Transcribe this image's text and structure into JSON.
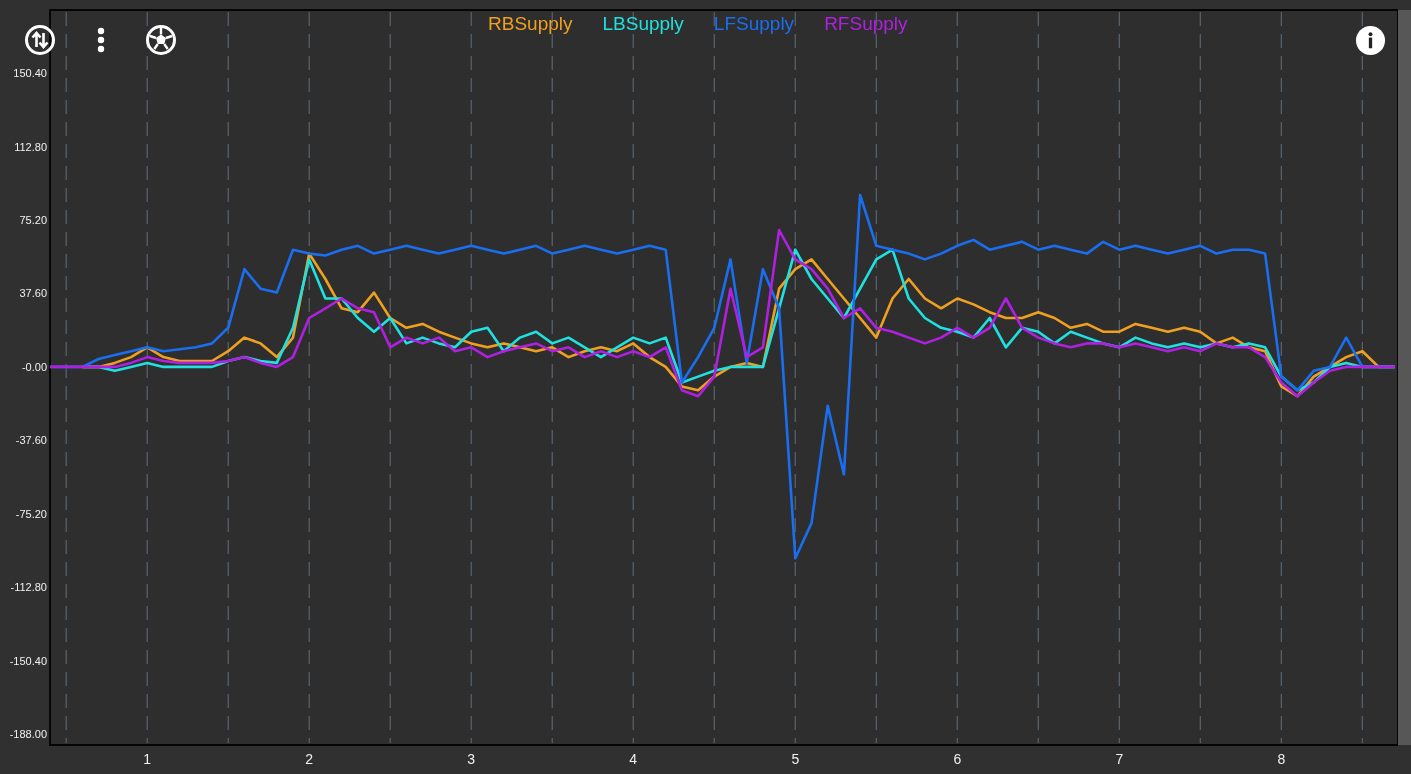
{
  "chart_data": {
    "type": "line",
    "x": [
      0.4,
      0.5,
      0.6,
      0.7,
      0.8,
      0.9,
      1.0,
      1.1,
      1.2,
      1.3,
      1.4,
      1.5,
      1.6,
      1.7,
      1.8,
      1.9,
      2.0,
      2.1,
      2.2,
      2.3,
      2.4,
      2.5,
      2.6,
      2.7,
      2.8,
      2.9,
      3.0,
      3.1,
      3.2,
      3.3,
      3.4,
      3.5,
      3.6,
      3.7,
      3.8,
      3.9,
      4.0,
      4.1,
      4.2,
      4.3,
      4.4,
      4.5,
      4.6,
      4.7,
      4.8,
      4.9,
      5.0,
      5.1,
      5.2,
      5.3,
      5.4,
      5.5,
      5.6,
      5.7,
      5.8,
      5.9,
      6.0,
      6.1,
      6.2,
      6.3,
      6.4,
      6.5,
      6.6,
      6.7,
      6.8,
      6.9,
      7.0,
      7.1,
      7.2,
      7.3,
      7.4,
      7.5,
      7.6,
      7.7,
      7.8,
      7.9,
      8.0,
      8.1,
      8.2,
      8.3,
      8.4,
      8.5,
      8.6,
      8.7
    ],
    "series": [
      {
        "name": "RBSupply",
        "color": "#f0a020",
        "values": [
          null,
          null,
          0,
          0,
          2,
          5,
          10,
          5,
          3,
          3,
          3,
          8,
          15,
          12,
          5,
          15,
          58,
          45,
          30,
          28,
          38,
          25,
          20,
          22,
          18,
          15,
          12,
          10,
          12,
          10,
          8,
          10,
          5,
          8,
          10,
          8,
          12,
          5,
          0,
          -10,
          -12,
          -5,
          0,
          2,
          0,
          40,
          50,
          55,
          45,
          35,
          25,
          15,
          35,
          45,
          35,
          30,
          35,
          32,
          28,
          25,
          25,
          28,
          25,
          20,
          22,
          18,
          18,
          22,
          20,
          18,
          20,
          18,
          12,
          15,
          10,
          8,
          -10,
          -15,
          -5,
          0,
          5,
          8,
          0,
          0
        ]
      },
      {
        "name": "LBSupply",
        "color": "#20e0e0",
        "values": [
          null,
          null,
          0,
          0,
          -2,
          0,
          2,
          0,
          0,
          0,
          0,
          3,
          5,
          3,
          2,
          20,
          55,
          35,
          35,
          25,
          18,
          25,
          12,
          15,
          12,
          10,
          18,
          20,
          8,
          15,
          18,
          12,
          15,
          10,
          5,
          10,
          15,
          12,
          15,
          -8,
          -5,
          -2,
          0,
          0,
          0,
          30,
          60,
          45,
          35,
          25,
          40,
          55,
          60,
          35,
          25,
          20,
          18,
          15,
          25,
          10,
          20,
          18,
          12,
          18,
          15,
          12,
          10,
          15,
          12,
          10,
          12,
          10,
          12,
          10,
          12,
          10,
          -5,
          -12,
          -8,
          0,
          2,
          0,
          0,
          0
        ]
      },
      {
        "name": "LFSupply",
        "color": "#1a6ef0",
        "values": [
          0,
          0,
          0,
          4,
          6,
          8,
          10,
          8,
          9,
          10,
          12,
          20,
          50,
          40,
          38,
          60,
          58,
          57,
          60,
          62,
          58,
          60,
          62,
          60,
          58,
          60,
          62,
          60,
          58,
          60,
          62,
          58,
          60,
          62,
          60,
          58,
          60,
          62,
          60,
          -8,
          5,
          20,
          55,
          2,
          50,
          30,
          -98,
          -80,
          -20,
          -55,
          88,
          62,
          60,
          58,
          55,
          58,
          62,
          65,
          60,
          62,
          64,
          60,
          62,
          60,
          58,
          64,
          60,
          62,
          60,
          58,
          60,
          62,
          58,
          60,
          60,
          58,
          -5,
          -12,
          -2,
          0,
          15,
          0,
          0,
          0
        ]
      },
      {
        "name": "RFSupply",
        "color": "#b020e0",
        "values": [
          0,
          0,
          0,
          0,
          0,
          2,
          5,
          3,
          2,
          2,
          2,
          3,
          5,
          2,
          0,
          5,
          25,
          30,
          35,
          30,
          28,
          10,
          15,
          12,
          15,
          8,
          10,
          5,
          8,
          10,
          12,
          8,
          10,
          5,
          8,
          5,
          8,
          5,
          10,
          -12,
          -15,
          -5,
          40,
          5,
          10,
          70,
          55,
          50,
          40,
          25,
          30,
          20,
          18,
          15,
          12,
          15,
          20,
          15,
          20,
          35,
          20,
          15,
          12,
          10,
          12,
          12,
          10,
          12,
          10,
          8,
          10,
          8,
          12,
          10,
          10,
          5,
          -8,
          -15,
          -8,
          -2,
          0,
          0,
          0,
          0
        ]
      }
    ],
    "grid": true,
    "xlim": [
      0.4,
      8.72
    ],
    "ylim": [
      -193.6,
      182.7
    ],
    "xticks": [
      1,
      2,
      3,
      4,
      5,
      6,
      7,
      8
    ],
    "yticks": [
      {
        "value": 150.4,
        "label": "150.40"
      },
      {
        "value": 112.8,
        "label": "112.80"
      },
      {
        "value": 75.2,
        "label": "75.20"
      },
      {
        "value": 37.6,
        "label": "37.60"
      },
      {
        "value": 0,
        "label": "-0.00"
      },
      {
        "value": -37.6,
        "label": "-37.60"
      },
      {
        "value": -75.2,
        "label": "-75.20"
      },
      {
        "value": -112.8,
        "label": "-112.80"
      },
      {
        "value": -150.4,
        "label": "-150.40"
      },
      {
        "value": -188,
        "label": "-188.00"
      }
    ]
  }
}
